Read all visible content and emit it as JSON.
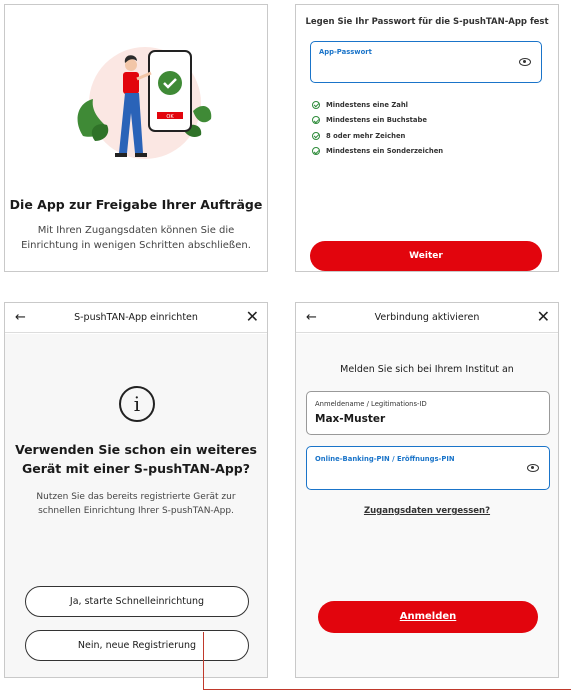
{
  "colors": {
    "accent_red": "#e2050d",
    "focus_blue": "#1a74c9",
    "check_green": "#2e8b3a"
  },
  "screen_intro": {
    "title": "Die App zur Freigabe Ihrer Aufträge",
    "text_line1": "Mit Ihren Zugangsdaten können Sie die",
    "text_line2": "Einrichtung in wenigen Schritten abschließen.",
    "illustration": "person-with-phone-checkmark-illustration"
  },
  "screen_password": {
    "heading": "Legen Sie Ihr Passwort für die S-pushTAN-App fest",
    "field_label": "App-Passwort",
    "toggle_icon": "eye-icon",
    "rules": [
      "Mindestens eine Zahl",
      "Mindestens ein Buchstabe",
      "8 oder mehr Zeichen",
      "Mindestens ein Sonderzeichen"
    ],
    "button": "Weiter"
  },
  "screen_setup": {
    "header_title": "S-pushTAN-App einrichten",
    "back_icon": "arrow-left-icon",
    "close_icon": "close-icon",
    "info_icon": "info-icon",
    "title_line1": "Verwenden Sie schon ein weiteres",
    "title_line2": "Gerät mit einer S-pushTAN-App?",
    "text_line1": "Nutzen Sie das bereits registrierte Gerät zur",
    "text_line2": "schnellen Einrichtung Ihrer S-pushTAN-App.",
    "button_yes": "Ja, starte Schnelleinrichtung",
    "button_no": "Nein, neue Registrierung"
  },
  "screen_login": {
    "header_title": "Verbindung aktivieren",
    "heading": "Melden Sie sich bei Ihrem Institut an",
    "username_label": "Anmeldename / Legitimations-ID",
    "username_value": "Max-Muster",
    "pin_label": "Online-Banking-PIN / Eröffnungs-PIN",
    "forgot_link": "Zugangsdaten vergessen?",
    "button": "Anmelden"
  }
}
